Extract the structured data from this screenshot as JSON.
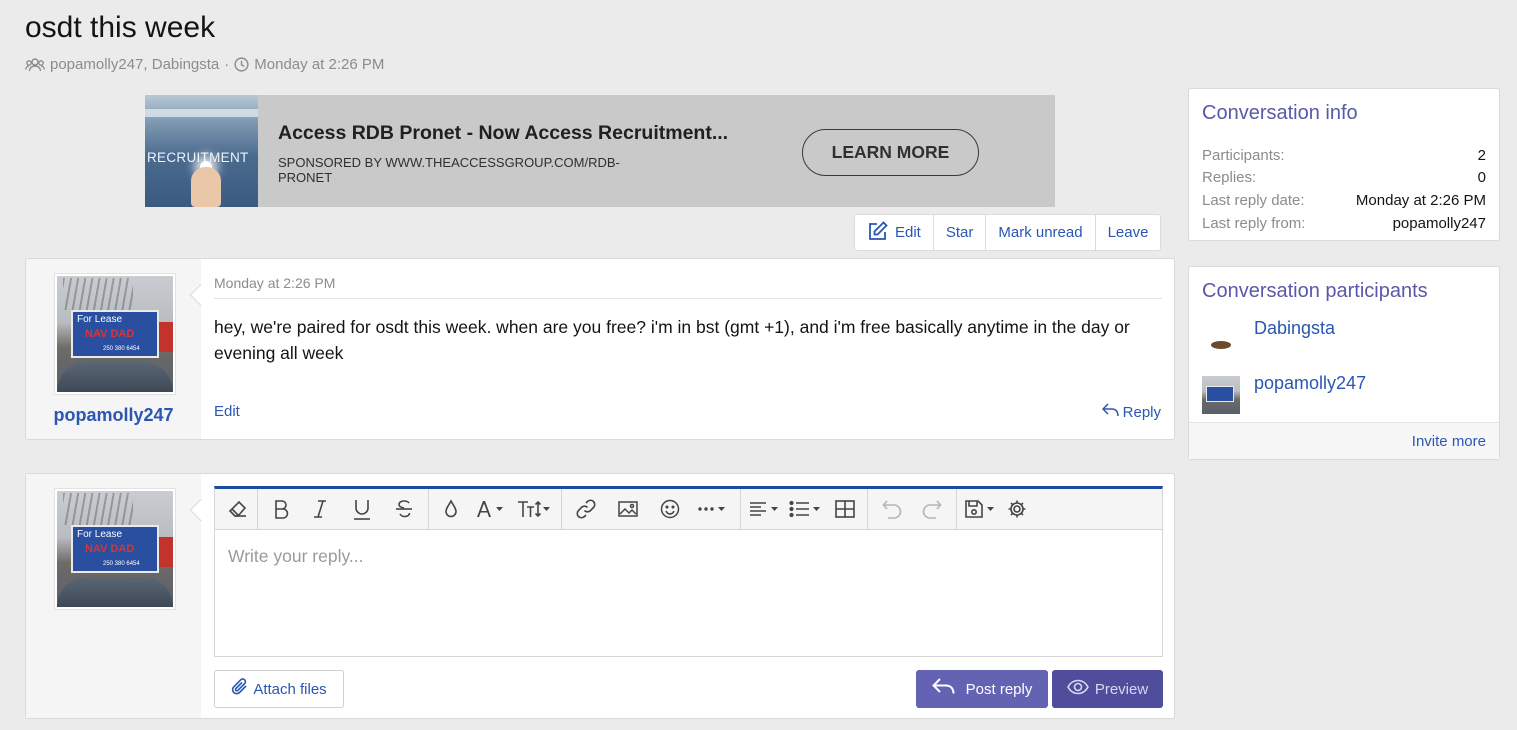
{
  "conversation": {
    "title": "osdt this week",
    "participants_text": "popamolly247, Dabingsta",
    "separator": "·",
    "date": "Monday at 2:26 PM"
  },
  "ad": {
    "image_text": "RECRUITMENT",
    "headline": "Access RDB Pronet - Now Access Recruitment...",
    "sponsor": "SPONSORED BY WWW.THEACCESSGROUP.COM/RDB-PRONET",
    "cta": "LEARN MORE"
  },
  "actions": {
    "edit": "Edit",
    "star": "Star",
    "mark_unread": "Mark unread",
    "leave": "Leave"
  },
  "message": {
    "author": "popamolly247",
    "date": "Monday at 2:26 PM",
    "text": "hey, we're paired for osdt this week. when are you free? i'm in bst (gmt +1), and i'm free basically anytime in the day or evening all week",
    "edit_label": "Edit",
    "reply_label": "Reply",
    "avatar_sign_line1": "For Lease",
    "avatar_sign_line2": "NAV DAD",
    "avatar_sign_line3": "250 380 6454"
  },
  "editor": {
    "placeholder": "Write your reply...",
    "attach_label": "Attach files",
    "post_label": "Post reply",
    "preview_label": "Preview"
  },
  "sidebar": {
    "info": {
      "title": "Conversation info",
      "rows": [
        {
          "label": "Participants:",
          "value": "2"
        },
        {
          "label": "Replies:",
          "value": "0"
        },
        {
          "label": "Last reply date:",
          "value": "Monday at 2:26 PM"
        },
        {
          "label": "Last reply from:",
          "value": "popamolly247"
        }
      ]
    },
    "participants": {
      "title": "Conversation participants",
      "users": [
        "Dabingsta",
        "popamolly247"
      ],
      "invite_label": "Invite more"
    }
  },
  "colors": {
    "link": "#2b56b3",
    "accent": "#5a58a8",
    "post_button": "#6462b3",
    "editor_border_top": "#1c4a9c",
    "page_bg": "#ebebeb"
  }
}
